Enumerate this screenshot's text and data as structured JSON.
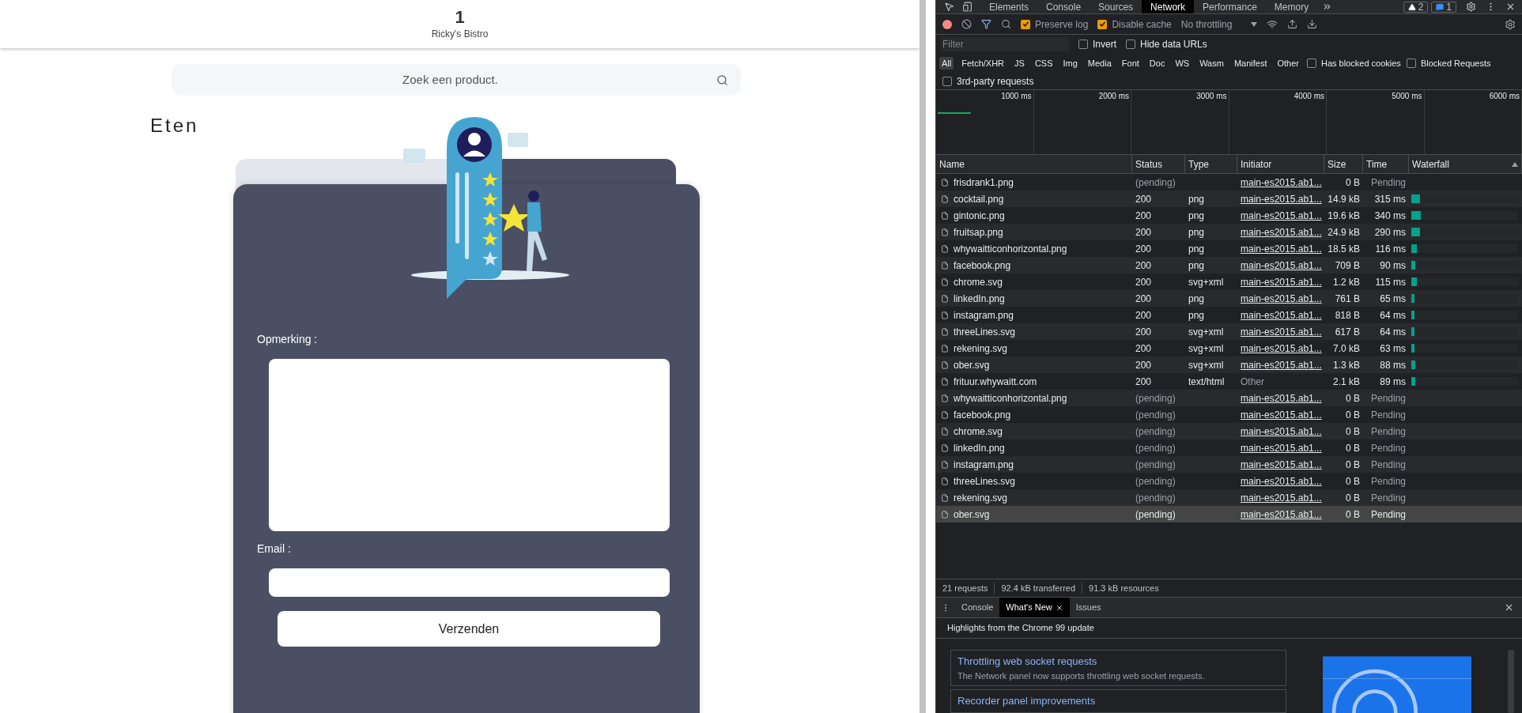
{
  "page": {
    "table_number": "1",
    "restaurant": "Ricky's Bistro",
    "search": {
      "placeholder": "Zoek een product."
    },
    "section_title": "Eten",
    "form": {
      "fields": [
        {
          "label": "Opmerking :",
          "kind": "textarea"
        },
        {
          "label": "Email :",
          "kind": "input"
        }
      ],
      "submit": "Verzenden"
    }
  },
  "devtools": {
    "tabs": [
      {
        "label": "Elements",
        "selected": false
      },
      {
        "label": "Console",
        "selected": false
      },
      {
        "label": "Sources",
        "selected": false
      },
      {
        "label": "Network",
        "selected": true
      },
      {
        "label": "Performance",
        "selected": false
      },
      {
        "label": "Memory",
        "selected": false
      }
    ],
    "badges": [
      {
        "kind": "warning",
        "count": "2"
      },
      {
        "kind": "message",
        "count": "1"
      }
    ],
    "toolbar": {
      "recording": true,
      "checkboxes": [
        {
          "label": "Preserve log",
          "checked": true
        },
        {
          "label": "Disable cache",
          "checked": true
        }
      ],
      "throttling": "No throttling"
    },
    "filter": {
      "placeholder": "Filter",
      "checkboxes": [
        {
          "label": "Invert",
          "checked": false
        },
        {
          "label": "Hide data URLs",
          "checked": false
        }
      ]
    },
    "type_filters": [
      {
        "label": "All",
        "selected": true
      },
      {
        "label": "Fetch/XHR",
        "selected": false
      },
      {
        "label": "JS",
        "selected": false
      },
      {
        "label": "CSS",
        "selected": false
      },
      {
        "label": "Img",
        "selected": false
      },
      {
        "label": "Media",
        "selected": false
      },
      {
        "label": "Font",
        "selected": false
      },
      {
        "label": "Doc",
        "selected": false
      },
      {
        "label": "WS",
        "selected": false
      },
      {
        "label": "Wasm",
        "selected": false
      },
      {
        "label": "Manifest",
        "selected": false
      },
      {
        "label": "Other",
        "selected": false
      }
    ],
    "extra_filters": [
      {
        "label": "Has blocked cookies",
        "checked": false
      },
      {
        "label": "Blocked Requests",
        "checked": false
      },
      {
        "label": "3rd-party requests",
        "checked": false
      }
    ],
    "timeline_ticks": [
      "1000 ms",
      "2000 ms",
      "3000 ms",
      "4000 ms",
      "5000 ms",
      "6000 ms"
    ],
    "columns": [
      "Name",
      "Status",
      "Type",
      "Initiator",
      "Size",
      "Time",
      "Waterfall"
    ],
    "rows": [
      {
        "name": "frisdrank1.png",
        "status": "(pending)",
        "type": "",
        "initiator": "main-es2015.ab1...",
        "initiator_link": true,
        "size": "0 B",
        "time": "Pending",
        "pending": true,
        "selected": false
      },
      {
        "name": "cocktail.png",
        "status": "200",
        "type": "png",
        "initiator": "main-es2015.ab1...",
        "initiator_link": true,
        "size": "14.9 kB",
        "time": "315 ms",
        "pending": false,
        "selected": false,
        "level": 0.08
      },
      {
        "name": "gintonic.png",
        "status": "200",
        "type": "png",
        "initiator": "main-es2015.ab1...",
        "initiator_link": true,
        "size": "19.6 kB",
        "time": "340 ms",
        "pending": false,
        "selected": false,
        "level": 0.09
      },
      {
        "name": "fruitsap.png",
        "status": "200",
        "type": "png",
        "initiator": "main-es2015.ab1...",
        "initiator_link": true,
        "size": "24.9 kB",
        "time": "290 ms",
        "pending": false,
        "selected": false,
        "level": 0.08
      },
      {
        "name": "whywaitticonhorizontal.png",
        "status": "200",
        "type": "png",
        "initiator": "main-es2015.ab1...",
        "initiator_link": true,
        "size": "18.5 kB",
        "time": "116 ms",
        "pending": false,
        "selected": false,
        "level": 0.05
      },
      {
        "name": "facebook.png",
        "status": "200",
        "type": "png",
        "initiator": "main-es2015.ab1...",
        "initiator_link": true,
        "size": "709 B",
        "time": "90 ms",
        "pending": false,
        "selected": false,
        "level": 0.04
      },
      {
        "name": "chrome.svg",
        "status": "200",
        "type": "svg+xml",
        "initiator": "main-es2015.ab1...",
        "initiator_link": true,
        "size": "1.2 kB",
        "time": "115 ms",
        "pending": false,
        "selected": false,
        "level": 0.05
      },
      {
        "name": "linkedIn.png",
        "status": "200",
        "type": "png",
        "initiator": "main-es2015.ab1...",
        "initiator_link": true,
        "size": "761 B",
        "time": "65 ms",
        "pending": false,
        "selected": false,
        "level": 0.03
      },
      {
        "name": "instagram.png",
        "status": "200",
        "type": "png",
        "initiator": "main-es2015.ab1...",
        "initiator_link": true,
        "size": "818 B",
        "time": "64 ms",
        "pending": false,
        "selected": false,
        "level": 0.03
      },
      {
        "name": "threeLines.svg",
        "status": "200",
        "type": "svg+xml",
        "initiator": "main-es2015.ab1...",
        "initiator_link": true,
        "size": "617 B",
        "time": "64 ms",
        "pending": false,
        "selected": false,
        "level": 0.03
      },
      {
        "name": "rekening.svg",
        "status": "200",
        "type": "svg+xml",
        "initiator": "main-es2015.ab1...",
        "initiator_link": true,
        "size": "7.0 kB",
        "time": "63 ms",
        "pending": false,
        "selected": false,
        "level": 0.03
      },
      {
        "name": "ober.svg",
        "status": "200",
        "type": "svg+xml",
        "initiator": "main-es2015.ab1...",
        "initiator_link": true,
        "size": "1.3 kB",
        "time": "88 ms",
        "pending": false,
        "selected": false,
        "level": 0.04
      },
      {
        "name": "frituur.whywaitt.com",
        "status": "200",
        "type": "text/html",
        "initiator": "Other",
        "initiator_link": false,
        "size": "2.1 kB",
        "time": "89 ms",
        "pending": false,
        "selected": false,
        "level": 0.04
      },
      {
        "name": "whywaitticonhorizontal.png",
        "status": "(pending)",
        "type": "",
        "initiator": "main-es2015.ab1...",
        "initiator_link": true,
        "size": "0 B",
        "time": "Pending",
        "pending": true,
        "selected": false
      },
      {
        "name": "facebook.png",
        "status": "(pending)",
        "type": "",
        "initiator": "main-es2015.ab1...",
        "initiator_link": true,
        "size": "0 B",
        "time": "Pending",
        "pending": true,
        "selected": false
      },
      {
        "name": "chrome.svg",
        "status": "(pending)",
        "type": "",
        "initiator": "main-es2015.ab1...",
        "initiator_link": true,
        "size": "0 B",
        "time": "Pending",
        "pending": true,
        "selected": false
      },
      {
        "name": "linkedIn.png",
        "status": "(pending)",
        "type": "",
        "initiator": "main-es2015.ab1...",
        "initiator_link": true,
        "size": "0 B",
        "time": "Pending",
        "pending": true,
        "selected": false
      },
      {
        "name": "instagram.png",
        "status": "(pending)",
        "type": "",
        "initiator": "main-es2015.ab1...",
        "initiator_link": true,
        "size": "0 B",
        "time": "Pending",
        "pending": true,
        "selected": false
      },
      {
        "name": "threeLines.svg",
        "status": "(pending)",
        "type": "",
        "initiator": "main-es2015.ab1...",
        "initiator_link": true,
        "size": "0 B",
        "time": "Pending",
        "pending": true,
        "selected": false
      },
      {
        "name": "rekening.svg",
        "status": "(pending)",
        "type": "",
        "initiator": "main-es2015.ab1...",
        "initiator_link": true,
        "size": "0 B",
        "time": "Pending",
        "pending": true,
        "selected": false
      },
      {
        "name": "ober.svg",
        "status": "(pending)",
        "type": "",
        "initiator": "main-es2015.ab1...",
        "initiator_link": true,
        "size": "0 B",
        "time": "Pending",
        "pending": true,
        "selected": true
      }
    ],
    "summary": [
      "21 requests",
      "92.4 kB transferred",
      "91.3 kB resources"
    ],
    "drawer": {
      "tabs": [
        {
          "label": "Console",
          "selected": false,
          "closable": false
        },
        {
          "label": "What's New",
          "selected": true,
          "closable": true
        },
        {
          "label": "Issues",
          "selected": false,
          "closable": false
        }
      ],
      "heading": "Highlights from the Chrome 99 update",
      "cards": [
        {
          "title": "Throttling web socket requests",
          "description": "The Network panel now supports throttling web socket requests."
        },
        {
          "title": "Recorder panel improvements"
        }
      ]
    }
  }
}
